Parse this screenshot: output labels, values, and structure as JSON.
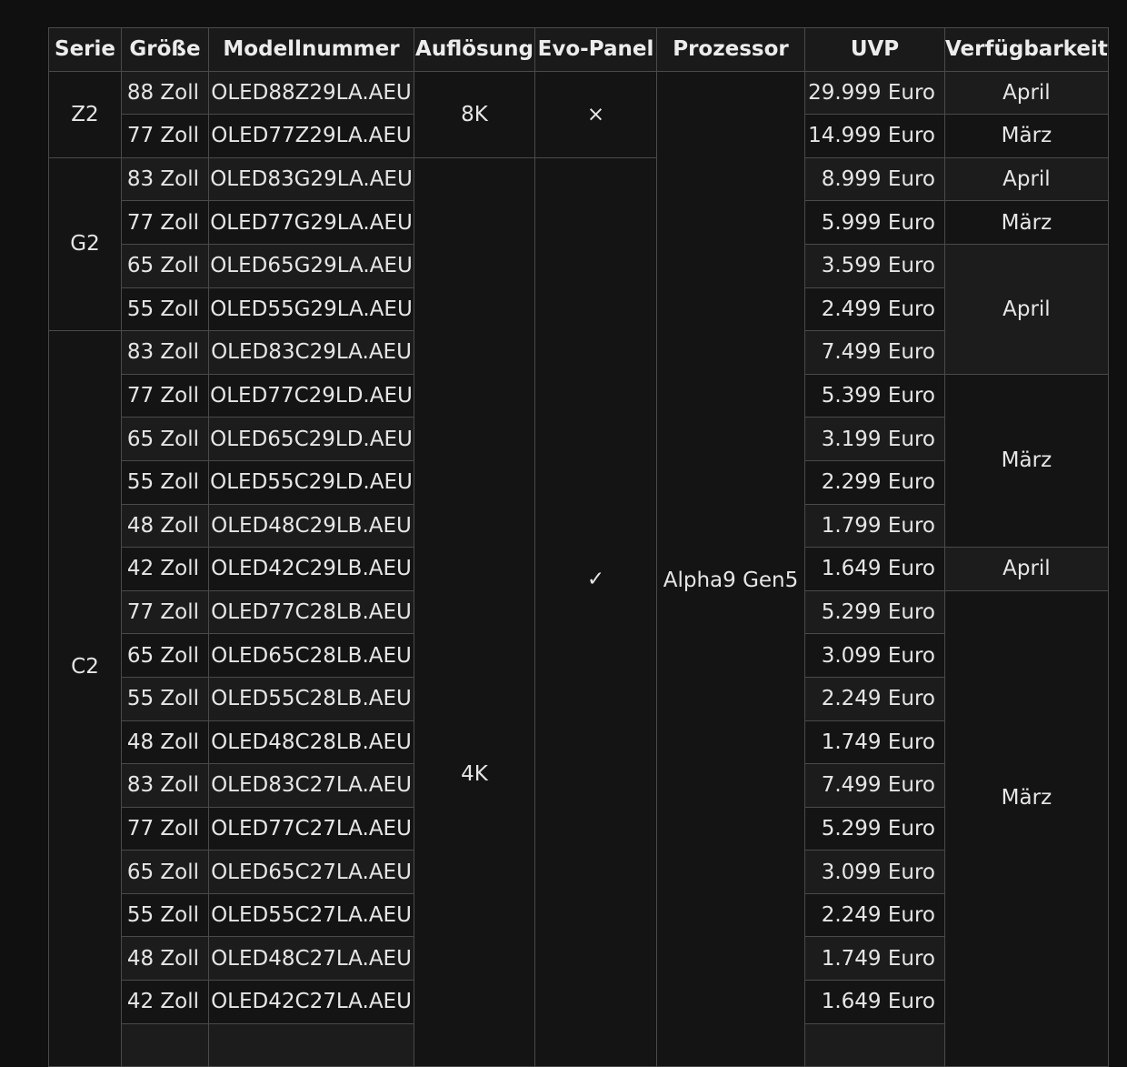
{
  "headers": [
    "Serie",
    "Größe",
    "Modellnummer",
    "Auflösung",
    "Evo-Panel",
    "Prozessor",
    "UVP",
    "Verfügbarkeit"
  ],
  "groups": {
    "z2": "Z2",
    "g2": "G2",
    "c2": "C2",
    "res_8k": "8K",
    "res_4k": "4K",
    "evo_no": "×",
    "evo_yes": "✓",
    "processor": "Alpha9 Gen5"
  },
  "rows": [
    {
      "size": "88 Zoll",
      "model": "OLED88Z29LA.AEU",
      "price": "29.999 Euro",
      "avail": "April"
    },
    {
      "size": "77 Zoll",
      "model": "OLED77Z29LA.AEU",
      "price": "14.999 Euro",
      "avail": "März"
    },
    {
      "size": "83 Zoll",
      "model": "OLED83G29LA.AEU",
      "price": "8.999 Euro",
      "avail": "April"
    },
    {
      "size": "77 Zoll",
      "model": "OLED77G29LA.AEU",
      "price": "5.999 Euro",
      "avail": "März"
    },
    {
      "size": "65 Zoll",
      "model": "OLED65G29LA.AEU",
      "price": "3.599 Euro",
      "avail": "April"
    },
    {
      "size": "55 Zoll",
      "model": "OLED55G29LA.AEU",
      "price": "2.499 Euro"
    },
    {
      "size": "83 Zoll",
      "model": "OLED83C29LA.AEU",
      "price": "7.499 Euro"
    },
    {
      "size": "77 Zoll",
      "model": "OLED77C29LD.AEU",
      "price": "5.399 Euro",
      "avail": "März"
    },
    {
      "size": "65 Zoll",
      "model": "OLED65C29LD.AEU",
      "price": "3.199 Euro"
    },
    {
      "size": "55 Zoll",
      "model": "OLED55C29LD.AEU",
      "price": "2.299 Euro"
    },
    {
      "size": "48 Zoll",
      "model": "OLED48C29LB.AEU",
      "price": "1.799 Euro"
    },
    {
      "size": "42 Zoll",
      "model": "OLED42C29LB.AEU",
      "price": "1.649 Euro",
      "avail": "April"
    },
    {
      "size": "77 Zoll",
      "model": "OLED77C28LB.AEU",
      "price": "5.299 Euro",
      "avail": "März"
    },
    {
      "size": "65 Zoll",
      "model": "OLED65C28LB.AEU",
      "price": "3.099 Euro"
    },
    {
      "size": "55 Zoll",
      "model": "OLED55C28LB.AEU",
      "price": "2.249 Euro"
    },
    {
      "size": "48 Zoll",
      "model": "OLED48C28LB.AEU",
      "price": "1.749 Euro"
    },
    {
      "size": "83 Zoll",
      "model": "OLED83C27LA.AEU",
      "price": "7.499 Euro"
    },
    {
      "size": "77 Zoll",
      "model": "OLED77C27LA.AEU",
      "price": "5.299 Euro"
    },
    {
      "size": "65 Zoll",
      "model": "OLED65C27LA.AEU",
      "price": "3.099 Euro"
    },
    {
      "size": "55 Zoll",
      "model": "OLED55C27LA.AEU",
      "price": "2.249 Euro"
    },
    {
      "size": "48 Zoll",
      "model": "OLED48C27LA.AEU",
      "price": "1.749 Euro"
    },
    {
      "size": "42 Zoll",
      "model": "OLED42C27LA.AEU",
      "price": "1.649 Euro"
    }
  ]
}
